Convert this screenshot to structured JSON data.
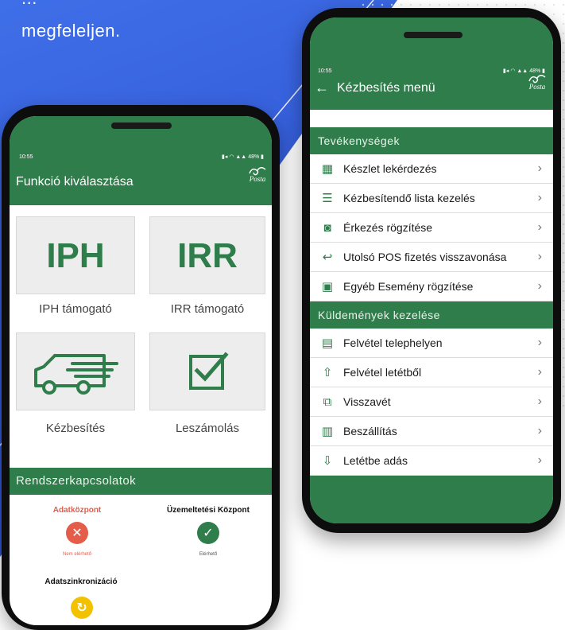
{
  "hero": {
    "line1": "...",
    "line2": "megfeleljen."
  },
  "status": {
    "time": "10:55",
    "battery": "48%"
  },
  "brand": {
    "logo_text": "Posta",
    "primary_color": "#2e7d4a"
  },
  "right_phone": {
    "title": "Kézbesítés menü",
    "sections": [
      {
        "title": "Tevékenységek",
        "items": [
          {
            "label": "Készlet lekérdezés",
            "icon": "inventory-icon"
          },
          {
            "label": "Kézbesítendő lista kezelés",
            "icon": "list-icon"
          },
          {
            "label": "Érkezés rögzítése",
            "icon": "arrival-icon"
          },
          {
            "label": "Utolsó POS fizetés visszavonása",
            "icon": "undo-icon"
          },
          {
            "label": "Egyéb Esemény rögzítése",
            "icon": "event-icon"
          }
        ]
      },
      {
        "title": "Küldemények kezelése",
        "items": [
          {
            "label": "Felvétel telephelyen",
            "icon": "site-icon"
          },
          {
            "label": "Felvétel letétből",
            "icon": "upload-icon"
          },
          {
            "label": "Visszavét",
            "icon": "return-icon"
          },
          {
            "label": "Beszállítás",
            "icon": "delivery-icon"
          },
          {
            "label": "Letétbe adás",
            "icon": "download-icon"
          }
        ]
      }
    ]
  },
  "left_phone": {
    "title": "Funkció kiválasztása",
    "tiles": [
      {
        "code": "IPH",
        "label": "IPH támogató"
      },
      {
        "code": "IRR",
        "label": "IRR támogató"
      },
      {
        "code": "",
        "label": "Kézbesítés",
        "icon": "truck-icon"
      },
      {
        "code": "",
        "label": "Leszámolás",
        "icon": "checkbox-icon"
      }
    ],
    "system_title": "Rendszerkapcsolatok",
    "systems": [
      {
        "name": "Adatközpont",
        "status": "Nem elérhető",
        "color": "#e35d4a"
      },
      {
        "name": "Üzemeltetési Központ",
        "status": "Elérhető",
        "color": "#2e7d4a"
      },
      {
        "name": "Adatszinkronizáció",
        "status": "",
        "color": "#f2c200"
      }
    ]
  }
}
